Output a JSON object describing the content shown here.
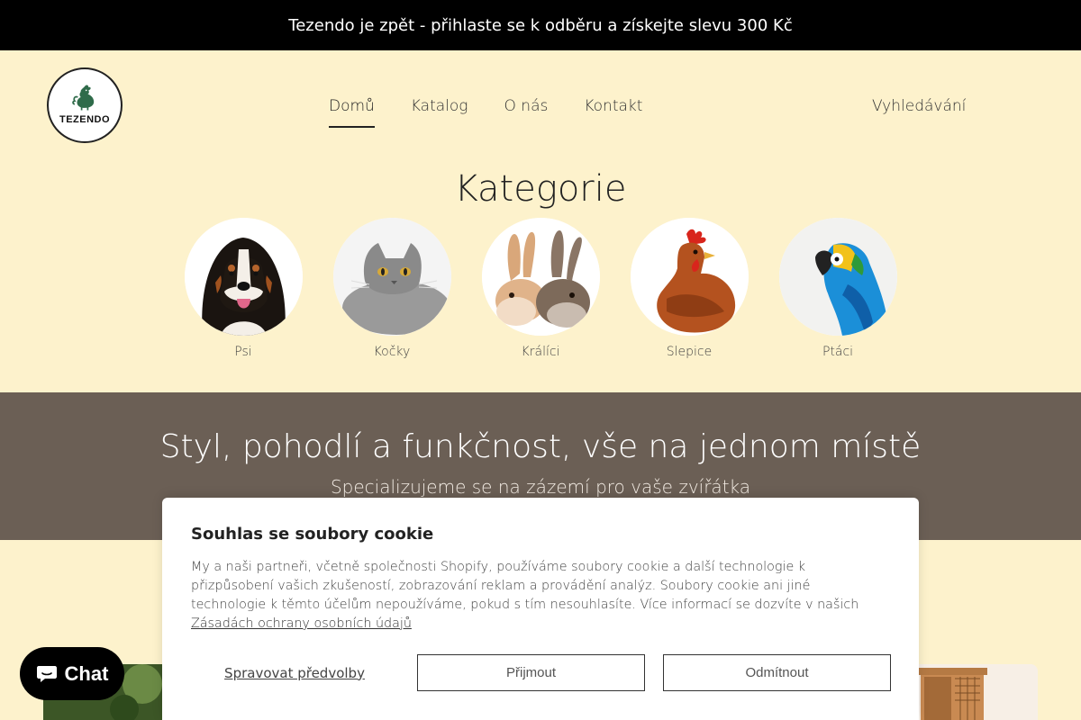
{
  "announcement": {
    "text": "Tezendo je zpět - přihlaste se k odběru a získejte slevu 300 Kč"
  },
  "logo": {
    "text": "TEZENDO",
    "icon": "rooster-icon"
  },
  "nav": {
    "items": [
      {
        "label": "Domů",
        "active": true
      },
      {
        "label": "Katalog"
      },
      {
        "label": "O nás"
      },
      {
        "label": "Kontakt"
      }
    ],
    "search_label": "Vyhledávání"
  },
  "categories": {
    "title": "Kategorie",
    "items": [
      {
        "label": "Psi",
        "image": "dog-photo"
      },
      {
        "label": "Kočky",
        "image": "cat-photo"
      },
      {
        "label": "Králíci",
        "image": "rabbit-photo"
      },
      {
        "label": "Slepice",
        "image": "chicken-photo"
      },
      {
        "label": "Ptáci",
        "image": "parrot-photo"
      }
    ]
  },
  "banner": {
    "title": "Styl, pohodlí a funkčnost, vše na jednom místě",
    "subtitle": "Specializujeme se na zázemí pro vaše zvířátka",
    "background": "#6b5f55"
  },
  "cookie": {
    "title": "Souhlas se soubory cookie",
    "body": "My a naši partneři, včetně společnosti Shopify, používáme soubory cookie a další technologie k přizpůsobení vašich zkušeností, zobrazování reklam a provádění analýz. Soubory cookie ani jiné technologie k těmto účelům nepoužíváme, pokud s tím nesouhlasíte. Více informací se dozvíte v našich",
    "link_text": "Zásadách ochrany osobních údajů",
    "manage_label": "Spravovat předvolby",
    "accept_label": "Přijmout",
    "decline_label": "Odmítnout"
  },
  "chat": {
    "label": "Chat",
    "icon": "chat-bubble-icon"
  },
  "colors": {
    "page_bg": "#fdf2cc",
    "announcement_bg": "#000000",
    "banner_bg": "#6b5f55"
  }
}
